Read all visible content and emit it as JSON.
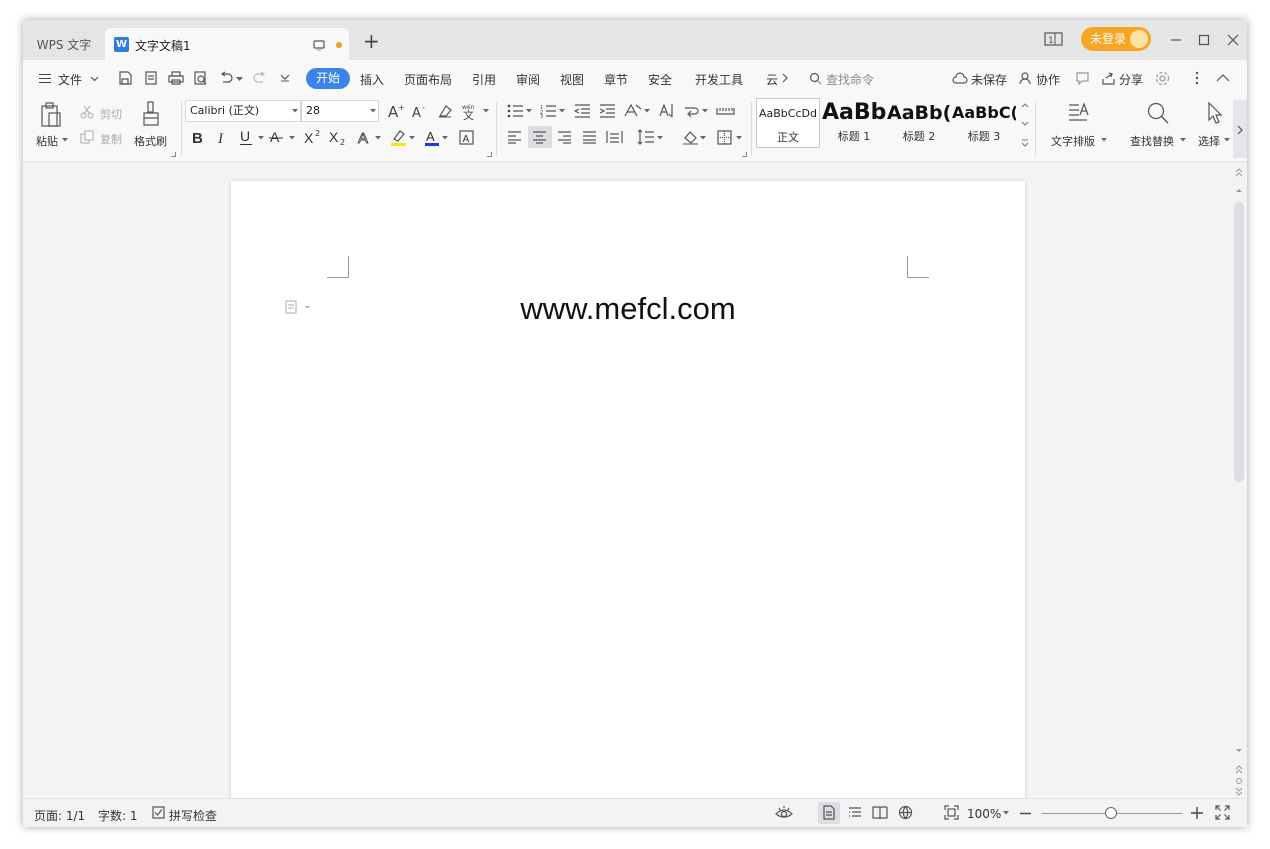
{
  "titlebar": {
    "app_tab": "WPS 文字",
    "doc_tab": "文字文稿1",
    "login": "未登录"
  },
  "menu": {
    "file": "文件",
    "tabs": [
      "开始",
      "插入",
      "页面布局",
      "引用",
      "审阅",
      "视图",
      "章节",
      "安全",
      "开发工具",
      "云"
    ],
    "search": "查找命令",
    "unsaved": "未保存",
    "collab": "协作",
    "share": "分享"
  },
  "ribbon": {
    "paste": "粘贴",
    "cut": "剪切",
    "copy": "复制",
    "format_painter": "格式刷",
    "font_name": "Calibri (正文)",
    "font_size": "28",
    "styles": [
      {
        "sample": "AaBbCcDd",
        "caption": "正文"
      },
      {
        "sample": "AaBb",
        "caption": "标题 1"
      },
      {
        "sample": "AaBb(",
        "caption": "标题 2"
      },
      {
        "sample": "AaBbC(",
        "caption": "标题 3"
      }
    ],
    "text_layout": "文字排版",
    "find_replace": "查找替换",
    "select": "选择"
  },
  "document": {
    "text": "www.mefcl.com"
  },
  "status": {
    "page": "页面: 1/1",
    "words": "字数: 1",
    "spell": "拼写检查",
    "zoom": "100%"
  },
  "colors": {
    "accent": "#3b85e8",
    "login_bg": "#f5a623",
    "dot": "#e8a020"
  }
}
